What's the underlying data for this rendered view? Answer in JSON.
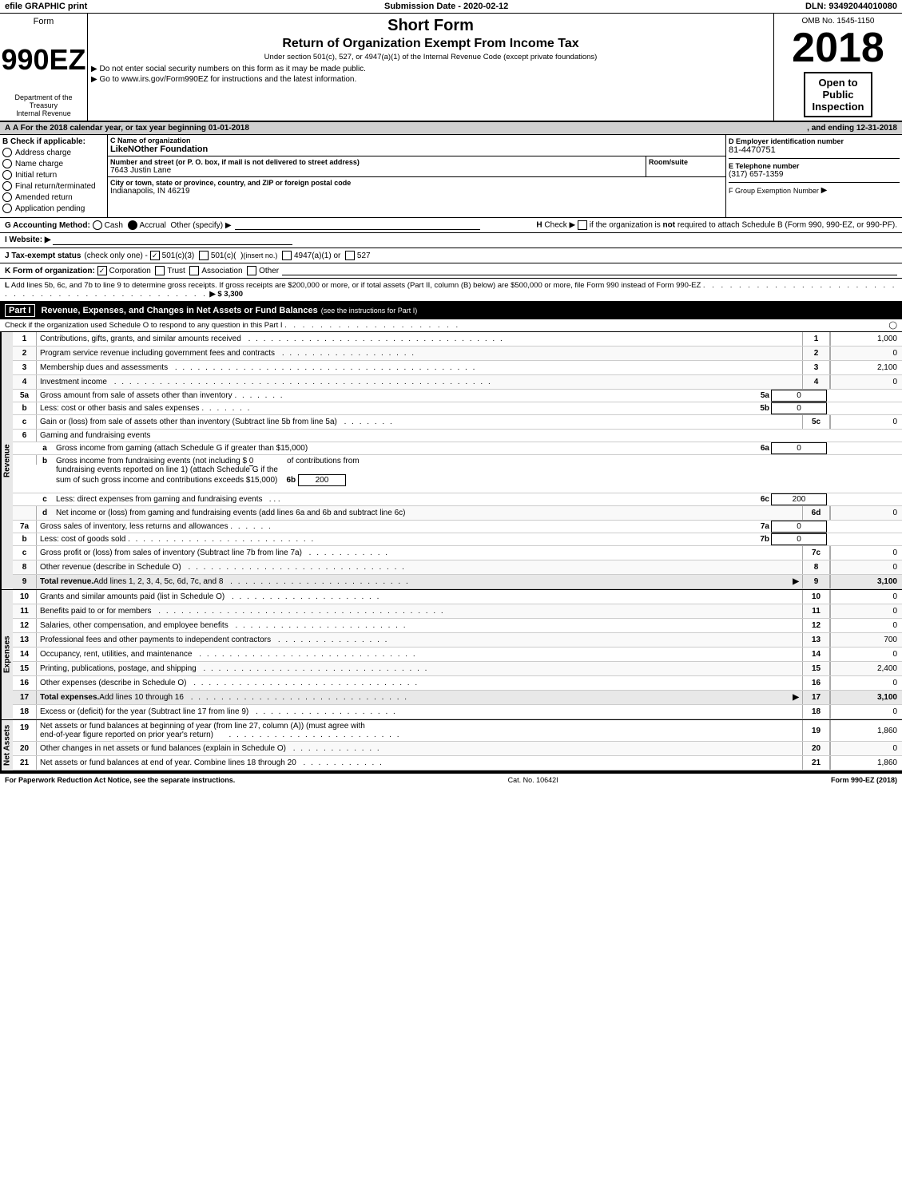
{
  "topbar": {
    "efile": "efile GRAPHIC print",
    "submission": "Submission Date - 2020-02-12",
    "dln": "DLN: 93492044010080"
  },
  "header": {
    "form_label": "Form",
    "form_number": "990EZ",
    "short_form": "Short Form",
    "return_title": "Return of Organization Exempt From Income Tax",
    "subtitle": "Under section 501(c), 527, or 4947(a)(1) of the Internal Revenue Code (except private foundations)",
    "note1": "▶ Do not enter social security numbers on this form as it may be made public.",
    "note2": "▶ Go to www.irs.gov/Form990EZ for instructions and the latest information.",
    "dept": "Department of the Treasury",
    "internal_revenue": "Internal Revenue",
    "omb": "OMB No. 1545-1150",
    "year": "2018",
    "open_to_public": "Open to",
    "public": "Public",
    "inspection": "Inspection"
  },
  "section_a": {
    "label": "A For the 2018 calendar year, or tax year beginning 01-01-2018",
    "ending": ", and ending 12-31-2018"
  },
  "section_b": {
    "label": "B Check if applicable:",
    "items": [
      {
        "id": "address-change",
        "text": "Address charge",
        "checked": false
      },
      {
        "id": "name-change",
        "text": "Name charge",
        "checked": false
      },
      {
        "id": "initial-return",
        "text": "Initial return",
        "checked": false
      },
      {
        "id": "final-return",
        "text": "Final return/terminated",
        "checked": false
      },
      {
        "id": "amended-return",
        "text": "Amended return",
        "checked": false
      },
      {
        "id": "application-pending",
        "text": "Application pending",
        "checked": false
      }
    ]
  },
  "section_c": {
    "label": "C Name of organization",
    "name": "LikeNOther Foundation"
  },
  "section_address": {
    "label": "Number and street (or P. O. box, if mail is not delivered to street address)",
    "value": "7643 Justin Lane",
    "room_label": "Room/suite",
    "room_value": ""
  },
  "section_city": {
    "label": "City or town, state or province, country, and ZIP or foreign postal code",
    "value": "Indianapolis, IN  46219"
  },
  "section_d": {
    "label": "D Employer identification number",
    "ein": "81-4470751"
  },
  "section_e": {
    "label": "E Telephone number",
    "phone": "(317) 657-1359"
  },
  "section_f": {
    "label": "F Group Exemption",
    "label2": "Number",
    "arrow": "▶"
  },
  "section_g": {
    "label": "G Accounting Method:",
    "cash": "Cash",
    "accrual": "Accrual",
    "accrual_checked": true,
    "other": "Other (specify) ▶",
    "line_value": ""
  },
  "section_h": {
    "label": "H Check ▶",
    "checkbox_label": "if the organization is not",
    "required": "required to attach Schedule B",
    "form_ref": "(Form 990, 990-EZ, or 990-PF)."
  },
  "section_i": {
    "label": "I Website: ▶"
  },
  "section_j": {
    "label": "J Tax-exempt status",
    "check_only": "(check only one) -",
    "option1": "501(c)(3)",
    "option1_checked": true,
    "option2": "501(c)(  )",
    "option2_insert": "(insert no.)",
    "option3": "4947(a)(1) or",
    "option4": "527"
  },
  "section_k": {
    "label": "K Form of organization:",
    "corp": "Corporation",
    "corp_checked": true,
    "trust": "Trust",
    "assoc": "Association",
    "other": "Other"
  },
  "section_l": {
    "text": "L Add lines 5b, 6c, and 7b to line 9 to determine gross receipts. If gross receipts are $200,000 or more, or if total assets (Part II, column (B) below) are $500,000 or more, file Form 990 instead of Form 990-EZ",
    "dots": ". . . . . . . . . . . . . . . . . . . . . . . . . . . . . . . . . . . . . . . . . . . . .",
    "arrow": "▶ $ 3,300"
  },
  "part1": {
    "label": "Part I",
    "title": "Revenue, Expenses, and Changes in Net Assets or Fund Balances",
    "see_instructions": "(see the instructions for Part I)",
    "schedule_o_check": "Check if the organization used Schedule O to respond to any question in this Part I",
    "rows": [
      {
        "num": "1",
        "desc": "Contributions, gifts, grants, and similar amounts received",
        "dots": true,
        "lineno": "1",
        "val": "1,000"
      },
      {
        "num": "2",
        "desc": "Program service revenue including government fees and contracts",
        "dots": true,
        "lineno": "2",
        "val": "0"
      },
      {
        "num": "3",
        "desc": "Membership dues and assessments",
        "dots": true,
        "lineno": "3",
        "val": "2,100"
      },
      {
        "num": "4",
        "desc": "Investment income",
        "dots": true,
        "lineno": "4",
        "val": "0"
      }
    ],
    "row5a": {
      "label": "5a",
      "desc": "Gross amount from sale of assets other than inventory",
      "dots": true,
      "box_label": "5a",
      "box_val": "0"
    },
    "row5b": {
      "label": "b",
      "desc": "Less: cost or other basis and sales expenses",
      "dots": true,
      "box_label": "5b",
      "box_val": "0"
    },
    "row5c": {
      "label": "c",
      "desc": "Gain or (loss) from sale of assets other than inventory (Subtract line 5b from line 5a)",
      "dots": true,
      "lineno": "5c",
      "val": "0"
    },
    "row6_title": "6  Gaming and fundraising events",
    "row6a": {
      "label": "a",
      "desc": "Gross income from gaming (attach Schedule G if greater than $15,000)",
      "box_label": "6a",
      "box_val": "0"
    },
    "row6b_desc": "b  Gross income from fundraising events (not including $",
    "row6b_val": "0",
    "row6b_cont": "of contributions from",
    "row6b_cont2": "fundraising events reported on line 1) (attach Schedule G if the",
    "row6b_cont3": "sum of such gross income and contributions exceeds $15,000)",
    "row6b_box_label": "6b",
    "row6b_box_val": "200",
    "row6c": {
      "label": "c",
      "desc": "Less: direct expenses from gaming and fundraising events",
      "dots3": ". . .",
      "box_label": "6c",
      "box_val": "200"
    },
    "row6d": {
      "label": "d",
      "desc": "Net income or (loss) from gaming and fundraising events (add lines 6a and 6b and subtract line 6c)",
      "lineno": "6d",
      "val": "0"
    },
    "row7a": {
      "label": "7a",
      "desc": "Gross sales of inventory, less returns and allowances",
      "dots": true,
      "box_label": "7a",
      "box_val": "0"
    },
    "row7b": {
      "label": "b",
      "desc": "Less: cost of goods sold",
      "dots": true,
      "box_label": "7b",
      "box_val": "0"
    },
    "row7c": {
      "label": "c",
      "desc": "Gross profit or (loss) from sales of inventory (Subtract line 7b from line 7a)",
      "dots": true,
      "lineno": "7c",
      "val": "0"
    },
    "row8": {
      "num": "8",
      "desc": "Other revenue (describe in Schedule O)",
      "dots": true,
      "lineno": "8",
      "val": "0"
    },
    "row9": {
      "num": "9",
      "desc": "Total revenue. Add lines 1, 2, 3, 4, 5c, 6d, 7c, and 8",
      "dots": true,
      "arrow": "▶",
      "lineno": "9",
      "val": "3,100"
    },
    "expenses_rows": [
      {
        "num": "10",
        "desc": "Grants and similar amounts paid (list in Schedule O)",
        "dots": true,
        "lineno": "10",
        "val": "0"
      },
      {
        "num": "11",
        "desc": "Benefits paid to or for members",
        "dots": true,
        "lineno": "11",
        "val": "0"
      },
      {
        "num": "12",
        "desc": "Salaries, other compensation, and employee benefits",
        "dots": true,
        "lineno": "12",
        "val": "0"
      },
      {
        "num": "13",
        "desc": "Professional fees and other payments to independent contractors",
        "dots": true,
        "lineno": "13",
        "val": "700"
      },
      {
        "num": "14",
        "desc": "Occupancy, rent, utilities, and maintenance",
        "dots": true,
        "lineno": "14",
        "val": "0"
      },
      {
        "num": "15",
        "desc": "Printing, publications, postage, and shipping",
        "dots": true,
        "lineno": "15",
        "val": "2,400"
      },
      {
        "num": "16",
        "desc": "Other expenses (describe in Schedule O)",
        "dots": true,
        "lineno": "16",
        "val": "0"
      }
    ],
    "row17": {
      "num": "17",
      "desc": "Total expenses. Add lines 10 through 16",
      "dots": true,
      "arrow": "▶",
      "lineno": "17",
      "val": "3,100"
    },
    "row18": {
      "num": "18",
      "desc": "Excess or (deficit) for the year (Subtract line 17 from line 9)",
      "dots": true,
      "lineno": "18",
      "val": "0"
    },
    "net_rows": [
      {
        "num": "19",
        "desc": "Net assets or fund balances at beginning of year (from line 27, column (A)) (must agree with end-of-year figure reported on prior year's return)",
        "dots": true,
        "lineno": "19",
        "val": "1,860"
      },
      {
        "num": "20",
        "desc": "Other changes in net assets or fund balances (explain in Schedule O)",
        "dots": true,
        "lineno": "20",
        "val": "0"
      },
      {
        "num": "21",
        "desc": "Net assets or fund balances at end of year. Combine lines 18 through 20",
        "dots": true,
        "lineno": "21",
        "val": "1,860"
      }
    ]
  },
  "footer": {
    "left": "For Paperwork Reduction Act Notice, see the separate instructions.",
    "cat": "Cat. No. 10642I",
    "right": "Form 990-EZ (2018)"
  }
}
